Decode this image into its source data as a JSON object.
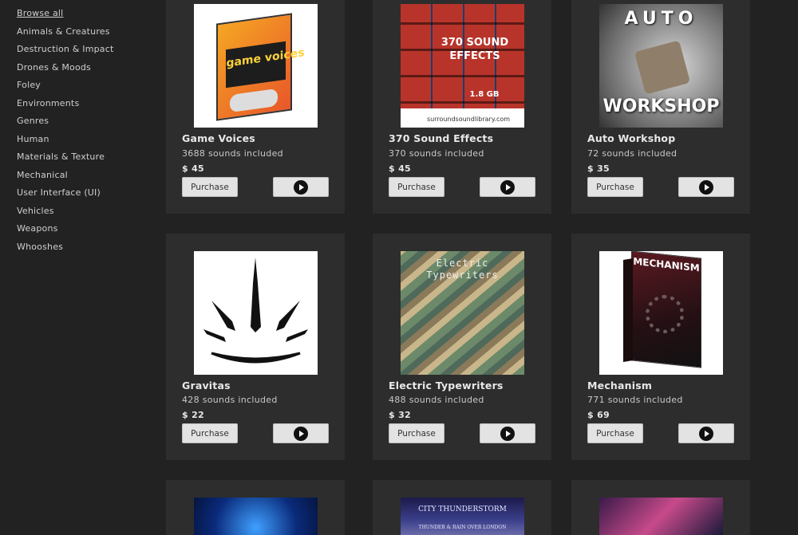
{
  "sidebar": {
    "items": [
      {
        "label": "Browse all"
      },
      {
        "label": "Animals & Creatures"
      },
      {
        "label": "Destruction & Impact"
      },
      {
        "label": "Drones & Moods"
      },
      {
        "label": "Foley"
      },
      {
        "label": "Environments"
      },
      {
        "label": "Genres"
      },
      {
        "label": "Human"
      },
      {
        "label": "Materials & Texture"
      },
      {
        "label": "Mechanical"
      },
      {
        "label": "User Interface (UI)"
      },
      {
        "label": "Vehicles"
      },
      {
        "label": "Weapons"
      },
      {
        "label": "Whooshes"
      }
    ]
  },
  "products": [
    {
      "title": "Game Voices",
      "count": "3688 sounds included",
      "price": "$ 45",
      "purchase_label": "Purchase",
      "art_text": "game voices"
    },
    {
      "title": "370 Sound Effects",
      "count": "370 sounds included",
      "price": "$ 45",
      "purchase_label": "Purchase",
      "art_text": "370 SOUND EFFECTS",
      "art_text2": "1.8 GB",
      "art_text3": "surroundsoundlibrary.com"
    },
    {
      "title": "Auto Workshop",
      "count": "72 sounds included",
      "price": "$ 35",
      "purchase_label": "Purchase",
      "art_text": "AUTO",
      "art_text2": "WORKSHOP"
    },
    {
      "title": "Gravitas",
      "count": "428 sounds included",
      "price": "$ 22",
      "purchase_label": "Purchase"
    },
    {
      "title": "Electric Typewriters",
      "count": "488 sounds included",
      "price": "$ 32",
      "purchase_label": "Purchase",
      "art_text": "Electric",
      "art_text2": "Typewriters"
    },
    {
      "title": "Mechanism",
      "count": "771 sounds included",
      "price": "$ 69",
      "purchase_label": "Purchase",
      "art_text": "MECHANISM"
    },
    {
      "art_text": "CITY THUNDERSTORM",
      "art_text2": "THUNDER & RAIN OVER LONDON"
    }
  ],
  "colors": {
    "background": "#222222",
    "card": "#2d2d2d",
    "button": "#e3e3e3"
  }
}
